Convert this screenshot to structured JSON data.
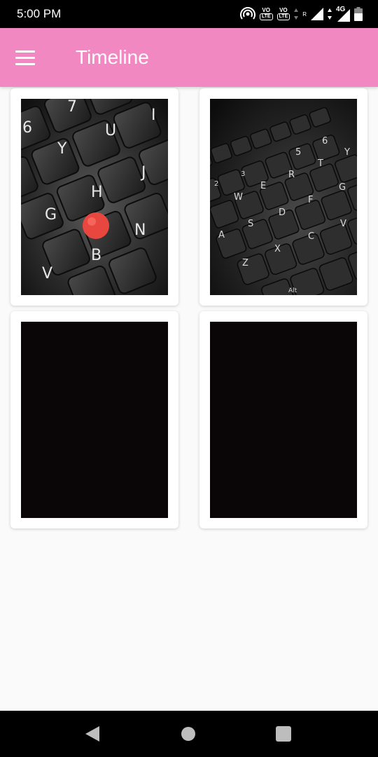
{
  "status_bar": {
    "time": "5:00 PM",
    "sim1_label": "VO",
    "sim1_badge": "LTE",
    "sim2_label": "VO",
    "sim2_badge": "LTE",
    "roaming": "R",
    "network": "4G"
  },
  "app_bar": {
    "title": "Timeline"
  },
  "keyboard_photo_1": {
    "keys": [
      "7",
      "6",
      "Y",
      "U",
      "I",
      "H",
      "J",
      "G",
      "N",
      "B",
      "V"
    ]
  },
  "keyboard_photo_2": {
    "keys": [
      "5",
      "6",
      "R",
      "T",
      "Y",
      "W",
      "E",
      "F",
      "G",
      "D",
      "S",
      "A",
      "C",
      "V",
      "X",
      "Z",
      "Alt",
      "3",
      "2"
    ]
  },
  "colors": {
    "app_bar": "#f288c2",
    "trackpoint": "#e8473f",
    "dark_photo": "#0a0608"
  }
}
